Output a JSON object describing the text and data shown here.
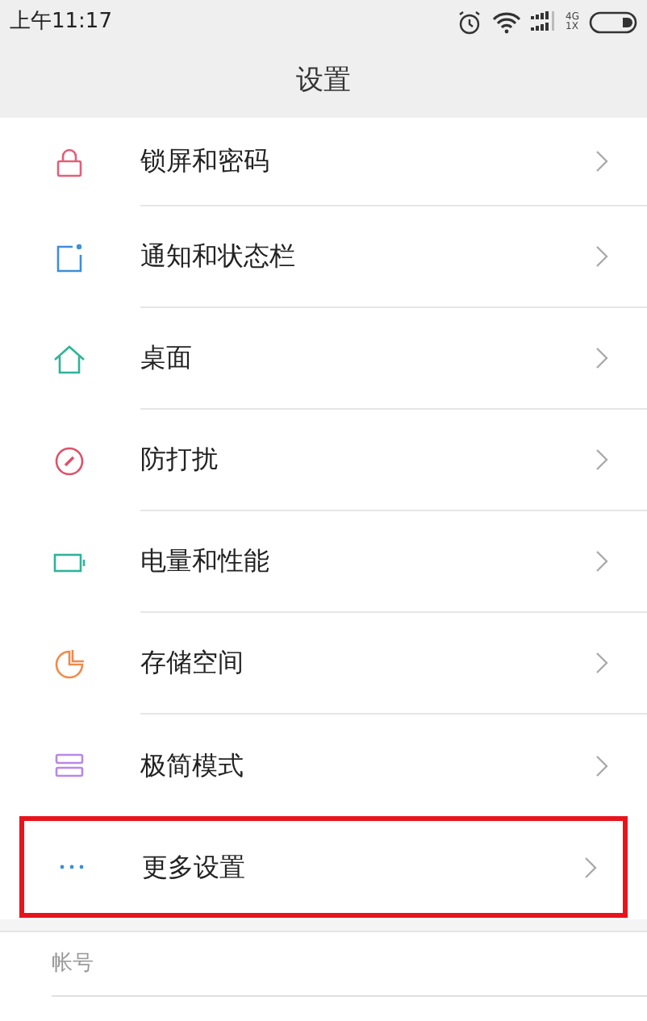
{
  "status_bar": {
    "time": "上午11:17",
    "network_top": "4G",
    "network_bottom": "1X"
  },
  "header": {
    "title": "设置"
  },
  "items": [
    {
      "label": "锁屏和密码",
      "highlighted": false
    },
    {
      "label": "通知和状态栏",
      "highlighted": false
    },
    {
      "label": "桌面",
      "highlighted": false
    },
    {
      "label": "防打扰",
      "highlighted": false
    },
    {
      "label": "电量和性能",
      "highlighted": false
    },
    {
      "label": "存储空间",
      "highlighted": false
    },
    {
      "label": "极简模式",
      "highlighted": false
    },
    {
      "label": "更多设置",
      "highlighted": true
    }
  ],
  "section": {
    "label": "帐号"
  }
}
